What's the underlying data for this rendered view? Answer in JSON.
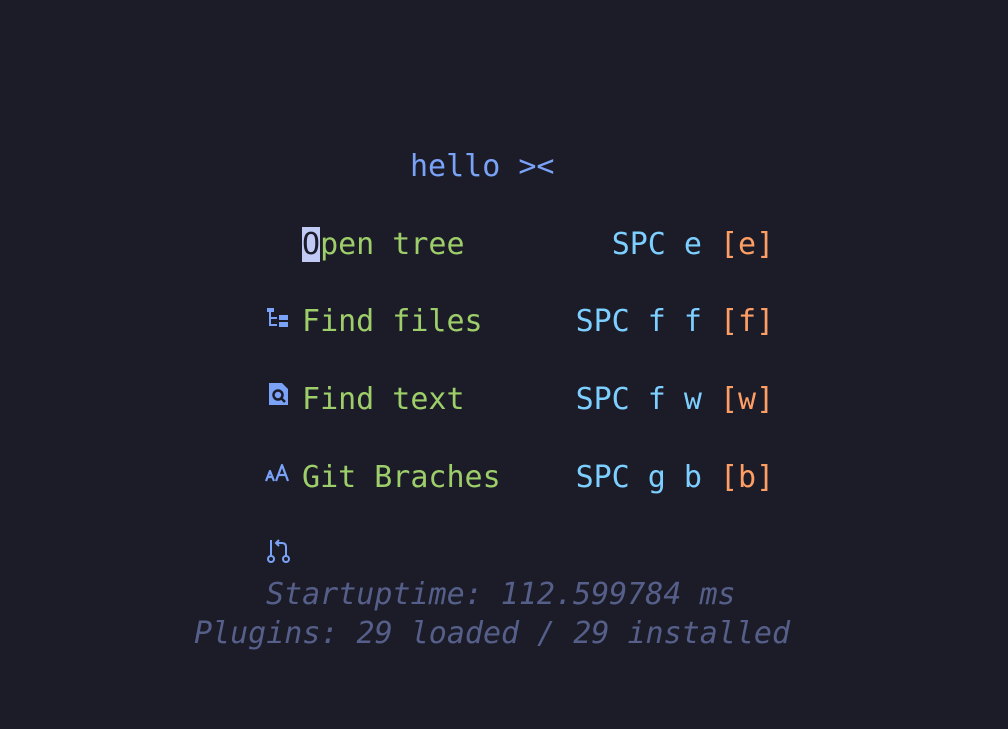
{
  "dashboard": {
    "header": "hello ><",
    "items": [
      {
        "icon": "folder-tree-icon",
        "label_first": "O",
        "label_rest": "pen tree",
        "keys": "SPC e",
        "shortcut": "[e]"
      },
      {
        "icon": "file-search-icon",
        "label_first": "F",
        "label_rest": "ind files",
        "keys": "SPC f f",
        "shortcut": "[f]"
      },
      {
        "icon": "text-size-icon",
        "label_first": "F",
        "label_rest": "ind text",
        "keys": "SPC f w",
        "shortcut": "[w]"
      },
      {
        "icon": "git-branch-icon",
        "label_first": "G",
        "label_rest": "it Braches",
        "keys": "SPC g b",
        "shortcut": "[b]"
      }
    ],
    "footer": {
      "startuptime": "Startuptime: 112.599784 ms",
      "plugins": "Plugins: 29 loaded / 29 installed"
    }
  },
  "colors": {
    "background": "#1b1c28",
    "header": "#7aa2f7",
    "label": "#9ece6a",
    "keys": "#7dcfff",
    "shortcut": "#ff9e64",
    "footer": "#565f89"
  }
}
